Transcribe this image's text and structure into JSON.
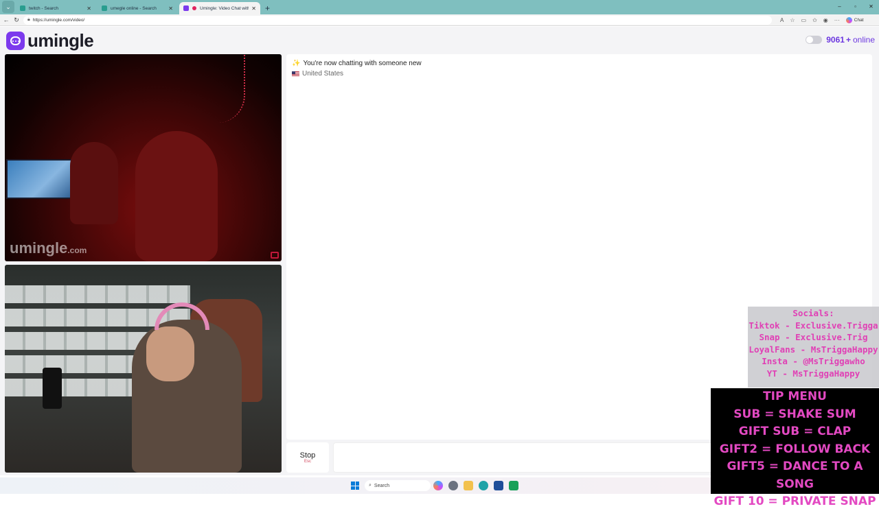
{
  "browser": {
    "tabs": [
      {
        "title": "twitch - Search",
        "active": false
      },
      {
        "title": "umegle online - Search",
        "active": false
      },
      {
        "title": "Umingle: Video Chat with Stra",
        "active": true
      }
    ],
    "new_tab": "+",
    "url": "https://umingle.com/video/",
    "copilot_label": "Chat",
    "window_controls": [
      "–",
      "▫",
      "✕"
    ]
  },
  "site": {
    "logo_text": "umingle",
    "online_count": "9061",
    "online_plus": "+",
    "online_label": "online"
  },
  "stranger_video": {
    "watermark": "umingle",
    "watermark_suffix": ".com"
  },
  "chat": {
    "status_message": "You're now chatting with someone new",
    "country": "United States"
  },
  "controls": {
    "stop_label": "Stop",
    "stop_shortcut": "Esc"
  },
  "overlay_socials": {
    "lines": [
      "Socials:",
      "Tiktok - Exclusive.Trigga",
      "Snap - Exclusive.Trig",
      "LoyalFans - MsTriggaHappy",
      "Insta - @MsTriggawho",
      "YT - MsTriggaHappy"
    ]
  },
  "overlay_tipmenu": {
    "lines": [
      "TIP MENU",
      "SUB = SHAKE SUM",
      "GIFT SUB = CLAP",
      "GIFT2 = FOLLOW BACK",
      "GIFT5 = DANCE TO A SONG",
      "GIFT 10 = PRIVATE SNAP"
    ]
  },
  "taskbar": {
    "search_placeholder": "Search"
  },
  "colors": {
    "brand": "#7c3aed",
    "online_text": "#6d38e0",
    "overlay_pink": "#e349c2"
  }
}
